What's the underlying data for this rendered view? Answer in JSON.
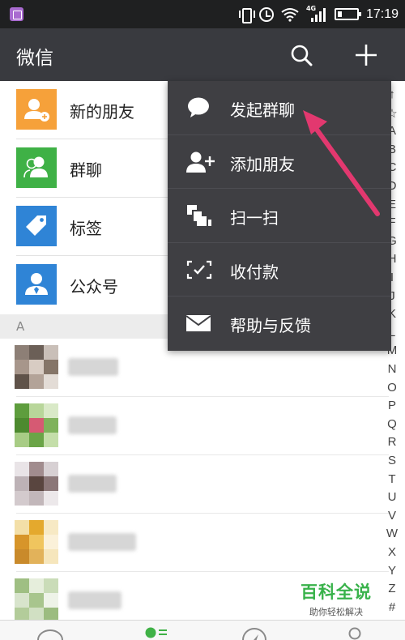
{
  "status_bar": {
    "network": "4G",
    "time": "17:19"
  },
  "header": {
    "title": "微信",
    "search_icon": "search-icon",
    "add_icon": "plus-icon"
  },
  "list": {
    "items": [
      {
        "label": "新的朋友",
        "icon": "add-friend-icon",
        "color": "#f6a13a"
      },
      {
        "label": "群聊",
        "icon": "group-icon",
        "color": "#3fb146"
      },
      {
        "label": "标签",
        "icon": "tag-icon",
        "color": "#2f84d6"
      },
      {
        "label": "公众号",
        "icon": "official-account-icon",
        "color": "#2f84d6"
      }
    ],
    "section_letter": "A"
  },
  "index_letters": [
    "↑",
    "☆",
    "A",
    "B",
    "C",
    "D",
    "E",
    "F",
    "G",
    "H",
    "I",
    "J",
    "K",
    "L",
    "M",
    "N",
    "O",
    "P",
    "Q",
    "R",
    "S",
    "T",
    "U",
    "V",
    "W",
    "X",
    "Y",
    "Z",
    "#"
  ],
  "menu": {
    "items": [
      {
        "label": "发起群聊",
        "icon": "chat-bubble-icon"
      },
      {
        "label": "添加朋友",
        "icon": "add-person-icon"
      },
      {
        "label": "扫一扫",
        "icon": "scan-icon"
      },
      {
        "label": "收付款",
        "icon": "payment-icon"
      },
      {
        "label": "帮助与反馈",
        "icon": "mail-icon"
      }
    ]
  },
  "watermark": {
    "title": "百科全说",
    "subtitle": "助你轻松解决"
  },
  "colors": {
    "header_bg": "#393a3f",
    "menu_bg": "#3f3f43",
    "arrow": "#e2386f",
    "accent_green": "#38b24a"
  }
}
